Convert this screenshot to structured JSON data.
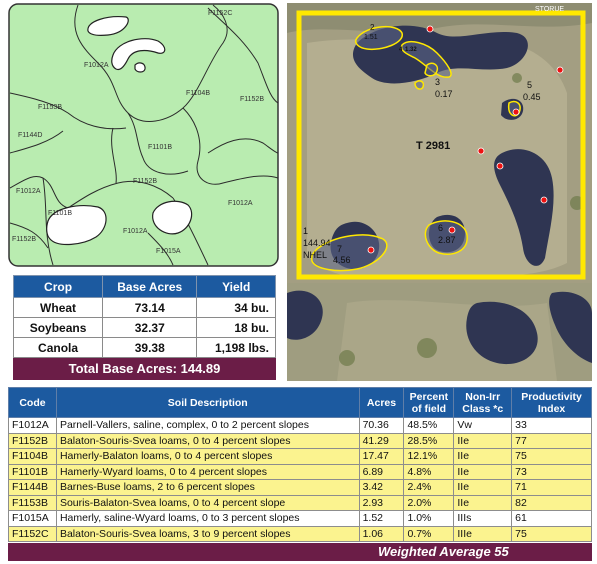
{
  "soil_map": {
    "labels": [
      "F1152C",
      "F1012A",
      "F1104B",
      "F1153B",
      "F1152B",
      "F1144D",
      "F1101B",
      "F1152B",
      "F1012A",
      "F1012A",
      "F1101B",
      "F1012A",
      "F1152B",
      "F1015A"
    ]
  },
  "aerial": {
    "corner_text": "STORUE",
    "tract": "T 2981",
    "fields": [
      {
        "num": "2",
        "acres": "1.51"
      },
      {
        "num": "4",
        "acres": "1.32"
      },
      {
        "num": "3",
        "acres": "0.17"
      },
      {
        "num": "5",
        "acres": "0.45"
      },
      {
        "num": "6",
        "acres": "2.87"
      },
      {
        "num": "7",
        "acres": "4.56"
      }
    ],
    "field1": {
      "num": "1",
      "acres": "144.94",
      "note": "NHEL"
    }
  },
  "crop_table": {
    "headers": [
      "Crop",
      "Base Acres",
      "Yield"
    ],
    "rows": [
      {
        "crop": "Wheat",
        "acres": "73.14",
        "yield": "34 bu."
      },
      {
        "crop": "Soybeans",
        "acres": "32.37",
        "yield": "18 bu."
      },
      {
        "crop": "Canola",
        "acres": "39.38",
        "yield": "1,198 lbs."
      }
    ],
    "total": "Total Base Acres:  144.89"
  },
  "soil_table": {
    "headers": {
      "code": "Code",
      "desc": "Soil Description",
      "acres": "Acres",
      "percent": "Percent of field",
      "class": "Non-Irr Class *c",
      "index": "Productivity Index"
    },
    "rows": [
      {
        "code": "F1012A",
        "desc": "Parnell-Vallers, saline, complex, 0 to 2 percent slopes",
        "acres": "70.36",
        "percent": "48.5%",
        "class": "Vw",
        "index": "33"
      },
      {
        "code": "F1152B",
        "desc": "Balaton-Souris-Svea loams, 0 to 4 percent slopes",
        "acres": "41.29",
        "percent": "28.5%",
        "class": "IIe",
        "index": "77"
      },
      {
        "code": "F1104B",
        "desc": "Hamerly-Balaton loams, 0 to 4 percent slopes",
        "acres": "17.47",
        "percent": "12.1%",
        "class": "IIe",
        "index": "75"
      },
      {
        "code": "F1101B",
        "desc": "Hamerly-Wyard loams, 0 to 4 percent slopes",
        "acres": "6.89",
        "percent": "4.8%",
        "class": "IIe",
        "index": "73"
      },
      {
        "code": "F1144B",
        "desc": "Barnes-Buse loams, 2 to 6 percent slopes",
        "acres": "3.42",
        "percent": "2.4%",
        "class": "IIe",
        "index": "71"
      },
      {
        "code": "F1153B",
        "desc": "Souris-Balaton-Svea loams, 0 to 4 percent slope",
        "acres": "2.93",
        "percent": "2.0%",
        "class": "IIe",
        "index": "82"
      },
      {
        "code": "F1015A",
        "desc": "Hamerly, saline-Wyard loams, 0 to 3 percent slopes",
        "acres": "1.52",
        "percent": "1.0%",
        "class": "IIIs",
        "index": "61"
      },
      {
        "code": "F1152C",
        "desc": "Balaton-Souris-Svea loams, 3 to 9 percent slopes",
        "acres": "1.06",
        "percent": "0.7%",
        "class": "IIIe",
        "index": "75"
      }
    ],
    "weighted": "Weighted Average  55"
  }
}
